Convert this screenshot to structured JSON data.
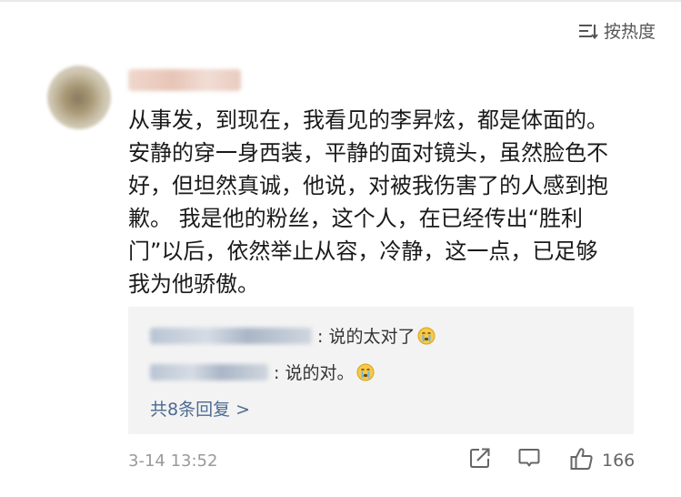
{
  "header": {
    "sort_label": "按热度",
    "sort_icon": "sort-lines-icon"
  },
  "comment": {
    "username": "",
    "text": "从事发，到现在，我看见的李昇炫，都是体面的。\n安静的穿一身西装，平静的面对镜头，虽然脸色不\n好，但坦然真诚，他说，对被我伤害了的人感到抱\n歉。 我是他的粉丝，这个人，在已经传出“胜利\n门”以后，依然举止从容，冷静，这一点，已足够\n我为他骄傲。",
    "time": "3-14 13:52"
  },
  "replies": {
    "items": [
      {
        "text": ": 说的太对了",
        "emoji": "crying-face-icon"
      },
      {
        "text": ": 说的对。",
        "emoji": "crying-face-icon"
      }
    ],
    "more_label": "共8条回复 >"
  },
  "actions": {
    "like_count": "166",
    "icons": [
      "share-icon",
      "comment-icon",
      "thumbs-up-icon"
    ]
  },
  "colors": {
    "link": "#4d6b91",
    "reply_bg": "#f3f3f3",
    "muted": "#9a9a9a"
  }
}
